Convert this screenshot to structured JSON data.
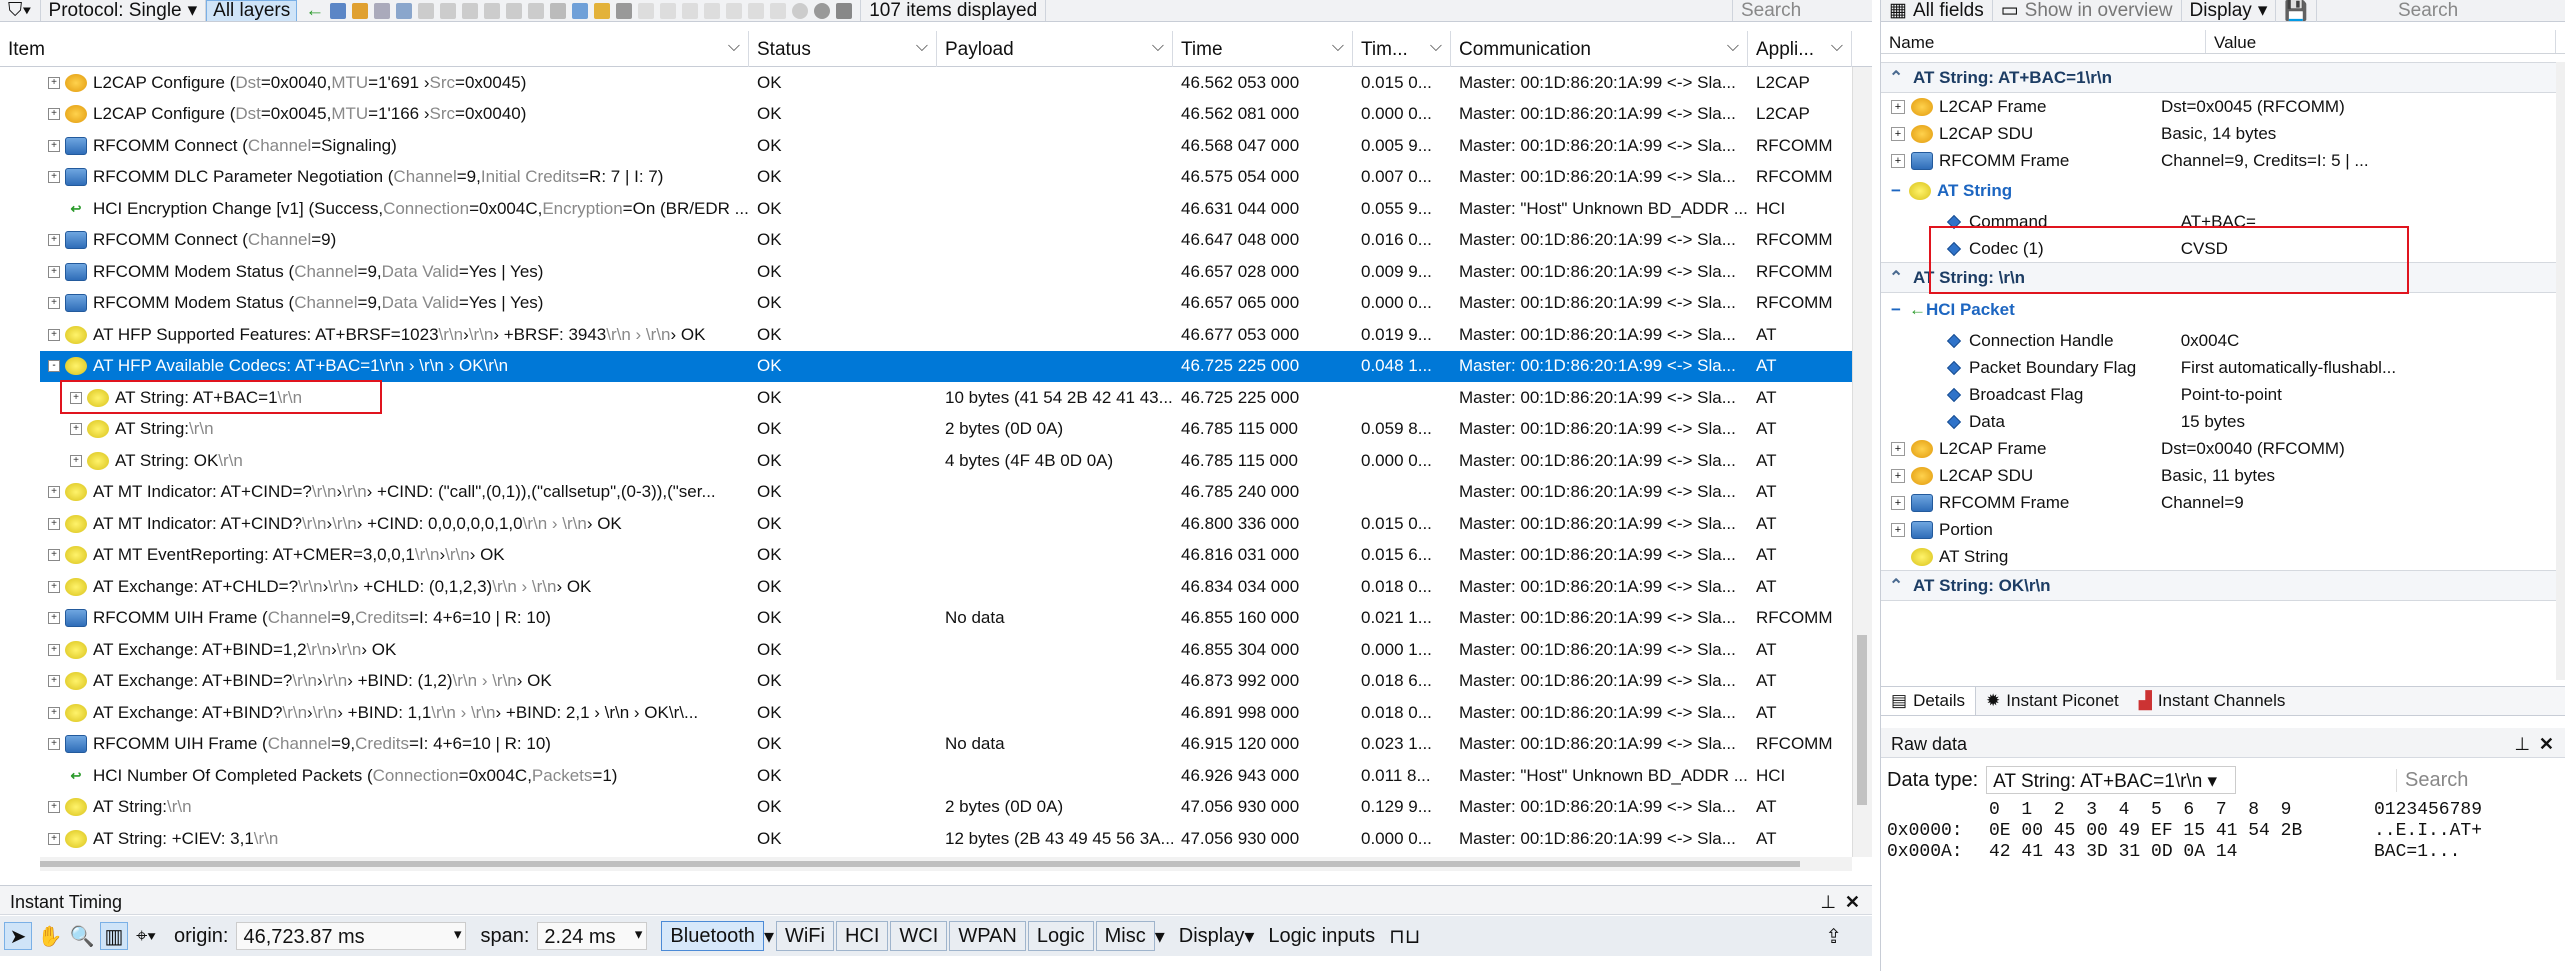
{
  "toolbar": {
    "protocol": "Protocol: Single",
    "all_layers": "All layers",
    "items_displayed": "107 items displayed",
    "search": "Search"
  },
  "columns": [
    "Item",
    "Status",
    "Payload",
    "Time",
    "Tim...",
    "Communication",
    "Appli..."
  ],
  "rows": [
    {
      "expand": "+",
      "icon": "l2",
      "child": false,
      "t": "L2CAP Configure (",
      "g1": "Dst",
      "e1": "=0x0040, ",
      "g2": "MTU",
      "e2": "=1'691 › ",
      "g3": "Src",
      "e3": "=0x0045)",
      "status": "OK",
      "payload": "",
      "time": "46.562 053 000",
      "tim": "0.015 0...",
      "comm": "Master: 00:1D:86:20:1A:99 <-> Sla...",
      "app": "L2CAP"
    },
    {
      "expand": "+",
      "icon": "l2",
      "child": false,
      "t": "L2CAP Configure (",
      "g1": "Dst",
      "e1": "=0x0045, ",
      "g2": "MTU",
      "e2": "=1'166 › ",
      "g3": "Src",
      "e3": "=0x0040)",
      "status": "OK",
      "payload": "",
      "time": "46.562 081 000",
      "tim": "0.000 0...",
      "comm": "Master: 00:1D:86:20:1A:99 <-> Sla...",
      "app": "L2CAP"
    },
    {
      "expand": "+",
      "icon": "rf",
      "child": false,
      "t": "RFCOMM Connect (",
      "g1": "Channel",
      "e1": "=Signaling)",
      "g2": "",
      "e2": "",
      "g3": "",
      "e3": "",
      "status": "OK",
      "payload": "",
      "time": "46.568 047 000",
      "tim": "0.005 9...",
      "comm": "Master: 00:1D:86:20:1A:99 <-> Sla...",
      "app": "RFCOMM"
    },
    {
      "expand": "+",
      "icon": "rf",
      "child": false,
      "t": "RFCOMM DLC Parameter Negotiation (",
      "g1": "Channel",
      "e1": "=9, ",
      "g2": "Initial Credits",
      "e2": "=R: 7 | I: 7)",
      "g3": "",
      "e3": "",
      "status": "OK",
      "payload": "",
      "time": "46.575 054 000",
      "tim": "0.007 0...",
      "comm": "Master: 00:1D:86:20:1A:99 <-> Sla...",
      "app": "RFCOMM"
    },
    {
      "expand": "",
      "icon": "hci",
      "child": false,
      "t": "HCI Encryption Change [v1] (Success, ",
      "g1": "Connection",
      "e1": "=0x004C, ",
      "g2": "Encryption",
      "e2": "=On (BR/EDR ...",
      "g3": "",
      "e3": "",
      "status": "OK",
      "payload": "",
      "time": "46.631 044 000",
      "tim": "0.055 9...",
      "comm": "Master: \"Host\" Unknown BD_ADDR ...",
      "app": "HCI"
    },
    {
      "expand": "+",
      "icon": "rf",
      "child": false,
      "t": "RFCOMM Connect (",
      "g1": "Channel",
      "e1": "=9)",
      "g2": "",
      "e2": "",
      "g3": "",
      "e3": "",
      "status": "OK",
      "payload": "",
      "time": "46.647 048 000",
      "tim": "0.016 0...",
      "comm": "Master: 00:1D:86:20:1A:99 <-> Sla...",
      "app": "RFCOMM"
    },
    {
      "expand": "+",
      "icon": "rf",
      "child": false,
      "t": "RFCOMM Modem Status (",
      "g1": "Channel",
      "e1": "=9, ",
      "g2": "Data Valid",
      "e2": "=Yes | Yes)",
      "g3": "",
      "e3": "",
      "status": "OK",
      "payload": "",
      "time": "46.657 028 000",
      "tim": "0.009 9...",
      "comm": "Master: 00:1D:86:20:1A:99 <-> Sla...",
      "app": "RFCOMM"
    },
    {
      "expand": "+",
      "icon": "rf",
      "child": false,
      "t": "RFCOMM Modem Status (",
      "g1": "Channel",
      "e1": "=9, ",
      "g2": "Data Valid",
      "e2": "=Yes | Yes)",
      "g3": "",
      "e3": "",
      "status": "OK",
      "payload": "",
      "time": "46.657 065 000",
      "tim": "0.000 0...",
      "comm": "Master: 00:1D:86:20:1A:99 <-> Sla...",
      "app": "RFCOMM"
    },
    {
      "expand": "+",
      "icon": "at",
      "child": false,
      "t": "AT HFP Supported Features: AT+BRSF=1023",
      "g1": "\\r\\n",
      "e1": " › ",
      "g2": "\\r\\n",
      "e2": " › +BRSF: 3943",
      "g3": "\\r\\n › \\r\\n",
      "e3": " › OK",
      "status": "OK",
      "payload": "",
      "time": "46.677 053 000",
      "tim": "0.019 9...",
      "comm": "Master: 00:1D:86:20:1A:99 <-> Sla...",
      "app": "AT"
    },
    {
      "expand": "-",
      "icon": "at",
      "child": false,
      "sel": true,
      "t": "AT HFP Available Codecs: AT+BAC=1\\r\\n › \\r\\n › OK\\r\\n",
      "g1": "",
      "e1": "",
      "g2": "",
      "e2": "",
      "g3": "",
      "e3": "",
      "status": "OK",
      "payload": "",
      "time": "46.725 225 000",
      "tim": "0.048 1...",
      "comm": "Master: 00:1D:86:20:1A:99 <-> Sla...",
      "app": "AT"
    },
    {
      "expand": "+",
      "icon": "at",
      "child": true,
      "t": "AT String: AT+BAC=1",
      "g1": "\\r\\n",
      "e1": "",
      "g2": "",
      "e2": "",
      "g3": "",
      "e3": "",
      "status": "OK",
      "payload": "10 bytes (41 54 2B 42 41 43...",
      "time": "46.725 225 000",
      "tim": "",
      "comm": "Master: 00:1D:86:20:1A:99 <-> Sla...",
      "app": "AT"
    },
    {
      "expand": "+",
      "icon": "at",
      "child": true,
      "t": "AT String: ",
      "g1": "\\r\\n",
      "e1": "",
      "g2": "",
      "e2": "",
      "g3": "",
      "e3": "",
      "status": "OK",
      "payload": "2 bytes (0D 0A)",
      "time": "46.785 115 000",
      "tim": "0.059 8...",
      "comm": "Master: 00:1D:86:20:1A:99 <-> Sla...",
      "app": "AT"
    },
    {
      "expand": "+",
      "icon": "at",
      "child": true,
      "t": "AT String: OK",
      "g1": "\\r\\n",
      "e1": "",
      "g2": "",
      "e2": "",
      "g3": "",
      "e3": "",
      "status": "OK",
      "payload": "4 bytes (4F 4B 0D 0A)",
      "time": "46.785 115 000",
      "tim": "0.000 0...",
      "comm": "Master: 00:1D:86:20:1A:99 <-> Sla...",
      "app": "AT"
    },
    {
      "expand": "+",
      "icon": "at",
      "child": false,
      "t": "AT MT Indicator: AT+CIND=?",
      "g1": "\\r\\n",
      "e1": " › ",
      "g2": "\\r\\n",
      "e2": " › +CIND: (\"call\",(0,1)),(\"callsetup\",(0-3)),(\"ser...",
      "g3": "",
      "e3": "",
      "status": "OK",
      "payload": "",
      "time": "46.785 240 000",
      "tim": "",
      "comm": "Master: 00:1D:86:20:1A:99 <-> Sla...",
      "app": "AT"
    },
    {
      "expand": "+",
      "icon": "at",
      "child": false,
      "t": "AT MT Indicator: AT+CIND?",
      "g1": "\\r\\n",
      "e1": " › ",
      "g2": "\\r\\n",
      "e2": " › +CIND: 0,0,0,0,0,1,0",
      "g3": "\\r\\n › \\r\\n",
      "e3": " › OK",
      "status": "OK",
      "payload": "",
      "time": "46.800 336 000",
      "tim": "0.015 0...",
      "comm": "Master: 00:1D:86:20:1A:99 <-> Sla...",
      "app": "AT"
    },
    {
      "expand": "+",
      "icon": "at",
      "child": false,
      "t": "AT MT EventReporting: AT+CMER=3,0,0,1",
      "g1": "\\r\\n",
      "e1": " › ",
      "g2": "\\r\\n",
      "e2": " › OK",
      "g3": "",
      "e3": "",
      "status": "OK",
      "payload": "",
      "time": "46.816 031 000",
      "tim": "0.015 6...",
      "comm": "Master: 00:1D:86:20:1A:99 <-> Sla...",
      "app": "AT"
    },
    {
      "expand": "+",
      "icon": "at",
      "child": false,
      "t": "AT Exchange: AT+CHLD=?",
      "g1": "\\r\\n",
      "e1": " › ",
      "g2": "\\r\\n",
      "e2": " › +CHLD: (0,1,2,3)",
      "g3": "\\r\\n › \\r\\n",
      "e3": " › OK",
      "status": "OK",
      "payload": "",
      "time": "46.834 034 000",
      "tim": "0.018 0...",
      "comm": "Master: 00:1D:86:20:1A:99 <-> Sla...",
      "app": "AT"
    },
    {
      "expand": "+",
      "icon": "rf",
      "child": false,
      "t": "RFCOMM UIH Frame (",
      "g1": "Channel",
      "e1": "=9, ",
      "g2": "Credits",
      "e2": "=I: 4+6=10 | R: 10)",
      "g3": "",
      "e3": "",
      "status": "OK",
      "payload": "No data",
      "time": "46.855 160 000",
      "tim": "0.021 1...",
      "comm": "Master: 00:1D:86:20:1A:99 <-> Sla...",
      "app": "RFCOMM"
    },
    {
      "expand": "+",
      "icon": "at",
      "child": false,
      "t": "AT Exchange: AT+BIND=1,2",
      "g1": "\\r\\n",
      "e1": " › ",
      "g2": "\\r\\n",
      "e2": " › OK",
      "g3": "",
      "e3": "",
      "status": "OK",
      "payload": "",
      "time": "46.855 304 000",
      "tim": "0.000 1...",
      "comm": "Master: 00:1D:86:20:1A:99 <-> Sla...",
      "app": "AT"
    },
    {
      "expand": "+",
      "icon": "at",
      "child": false,
      "t": "AT Exchange: AT+BIND=?",
      "g1": "\\r\\n",
      "e1": " › ",
      "g2": "\\r\\n",
      "e2": " › +BIND: (1,2)",
      "g3": "\\r\\n › \\r\\n",
      "e3": " › OK",
      "status": "OK",
      "payload": "",
      "time": "46.873 992 000",
      "tim": "0.018 6...",
      "comm": "Master: 00:1D:86:20:1A:99 <-> Sla...",
      "app": "AT"
    },
    {
      "expand": "+",
      "icon": "at",
      "child": false,
      "t": "AT Exchange: AT+BIND?",
      "g1": "\\r\\n",
      "e1": " › ",
      "g2": "\\r\\n",
      "e2": " › +BIND: 1,1",
      "g3": "\\r\\n › \\r\\n",
      "e3": " › +BIND: 2,1 › \\r\\n › OK\\r\\...",
      "status": "OK",
      "payload": "",
      "time": "46.891 998 000",
      "tim": "0.018 0...",
      "comm": "Master: 00:1D:86:20:1A:99 <-> Sla...",
      "app": "AT"
    },
    {
      "expand": "+",
      "icon": "rf",
      "child": false,
      "t": "RFCOMM UIH Frame (",
      "g1": "Channel",
      "e1": "=9, ",
      "g2": "Credits",
      "e2": "=I: 4+6=10 | R: 10)",
      "g3": "",
      "e3": "",
      "status": "OK",
      "payload": "No data",
      "time": "46.915 120 000",
      "tim": "0.023 1...",
      "comm": "Master: 00:1D:86:20:1A:99 <-> Sla...",
      "app": "RFCOMM"
    },
    {
      "expand": "",
      "icon": "hci",
      "child": false,
      "t": "HCI Number Of Completed Packets (",
      "g1": "Connection",
      "e1": "=0x004C, ",
      "g2": "Packets",
      "e2": "=1)",
      "g3": "",
      "e3": "",
      "status": "OK",
      "payload": "",
      "time": "46.926 943 000",
      "tim": "0.011 8...",
      "comm": "Master: \"Host\" Unknown BD_ADDR ...",
      "app": "HCI"
    },
    {
      "expand": "+",
      "icon": "at",
      "child": false,
      "t": "AT String: ",
      "g1": "\\r\\n",
      "e1": "",
      "g2": "",
      "e2": "",
      "g3": "",
      "e3": "",
      "status": "OK",
      "payload": "2 bytes (0D 0A)",
      "time": "47.056 930 000",
      "tim": "0.129 9...",
      "comm": "Master: 00:1D:86:20:1A:99 <-> Sla...",
      "app": "AT"
    },
    {
      "expand": "+",
      "icon": "at",
      "child": false,
      "t": "AT String: +CIEV: 3,1",
      "g1": "\\r\\n",
      "e1": "",
      "g2": "",
      "e2": "",
      "g3": "",
      "e3": "",
      "status": "OK",
      "payload": "12 bytes (2B 43 49 45 56 3A...",
      "time": "47.056 930 000",
      "tim": "0.000 0...",
      "comm": "Master: 00:1D:86:20:1A:99 <-> Sla...",
      "app": "AT"
    }
  ],
  "instant_timing": {
    "title": "Instant Timing",
    "origin_label": "origin:",
    "origin": "46,723.87 ms",
    "span_label": "span:",
    "span": "2.24 ms",
    "buttons": [
      "Bluetooth",
      "WiFi",
      "HCI",
      "WCI",
      "WPAN",
      "Logic",
      "Misc"
    ],
    "display": "Display",
    "logic_inputs": "Logic inputs"
  },
  "details": {
    "all_fields": "All fields",
    "show_overview": "Show in overview",
    "display": "Display",
    "search": "Search",
    "col_name": "Name",
    "col_value": "Value",
    "sec1": "AT String: AT+BAC=1\\r\\n",
    "sec1_rows": [
      {
        "n": "L2CAP Frame",
        "v": "Dst=0x0045 (RFCOMM)",
        "icon": "l2"
      },
      {
        "n": "L2CAP SDU",
        "v": "Basic, 14 bytes",
        "icon": "l2"
      },
      {
        "n": "RFCOMM Frame",
        "v": "Channel=9, Credits=I: 5 | ...",
        "icon": "rf"
      }
    ],
    "atstring": "AT String",
    "at_fields": [
      {
        "n": "Command",
        "v": "AT+BAC="
      },
      {
        "n": "Codec (1)",
        "v": "CVSD"
      }
    ],
    "sec2": "AT String: \\r\\n",
    "hci_packet": "HCI Packet",
    "hci_fields": [
      {
        "n": "Connection Handle",
        "v": "0x004C"
      },
      {
        "n": "Packet Boundary Flag",
        "v": "First automatically-flushabl..."
      },
      {
        "n": "Broadcast Flag",
        "v": "Point-to-point"
      },
      {
        "n": "Data",
        "v": "15 bytes"
      }
    ],
    "sec2_rows": [
      {
        "n": "L2CAP Frame",
        "v": "Dst=0x0040 (RFCOMM)",
        "icon": "l2"
      },
      {
        "n": "L2CAP SDU",
        "v": "Basic, 11 bytes",
        "icon": "l2"
      },
      {
        "n": "RFCOMM Frame",
        "v": "Channel=9",
        "icon": "rf"
      },
      {
        "n": "Portion",
        "v": "",
        "icon": "rf"
      },
      {
        "n": "AT String",
        "v": "",
        "icon": "at"
      }
    ],
    "sec3": "AT String: OK\\r\\n",
    "tabs": [
      "Details",
      "Instant Piconet",
      "Instant Channels"
    ]
  },
  "raw": {
    "title": "Raw data",
    "dtype_label": "Data type:",
    "dtype": "AT String: AT+BAC=1\\r\\n",
    "search": "Search",
    "hex_header": "0  1  2  3  4  5  6  7  8  9",
    "ascii_header": "0123456789",
    "lines": [
      {
        "addr": "0x0000:",
        "bytes": "0E 00 45 00 49 EF 15 41 54 2B",
        "ascii": "..E.I..AT+"
      },
      {
        "addr": "0x000A:",
        "bytes": "42 41 43 3D 31 0D 0A 14",
        "ascii": "BAC=1..."
      }
    ]
  }
}
